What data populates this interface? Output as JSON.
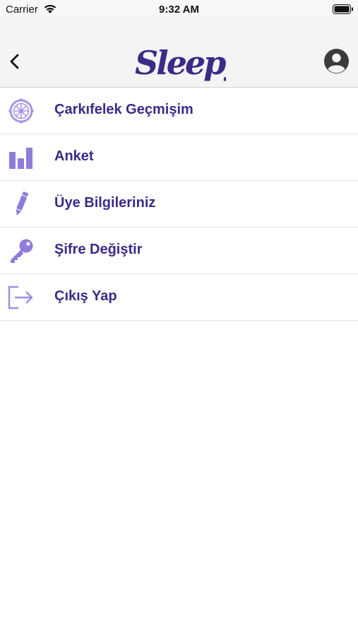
{
  "status_bar": {
    "carrier": "Carrier",
    "time": "9:32 AM",
    "icons": [
      "wifi-icon",
      "battery-icon"
    ]
  },
  "header": {
    "logo_text": "Sleepy",
    "back_icon": "chevron-left-icon",
    "profile_icon": "user-avatar-icon"
  },
  "menu": {
    "items": [
      {
        "label": "Çarkıfelek Geçmişim",
        "icon": "wheel-of-fortune-icon"
      },
      {
        "label": "Anket",
        "icon": "bar-chart-icon"
      },
      {
        "label": "Üye Bilgileriniz",
        "icon": "pencil-icon"
      },
      {
        "label": "Şifre Değiştir",
        "icon": "key-icon"
      },
      {
        "label": "Çıkış Yap",
        "icon": "logout-icon"
      }
    ]
  },
  "colors": {
    "brand_text": "#3c2a86",
    "icon_light": "#9d8de0",
    "icon_mid": "#8f7cdb",
    "logo": "#3c2a86"
  }
}
